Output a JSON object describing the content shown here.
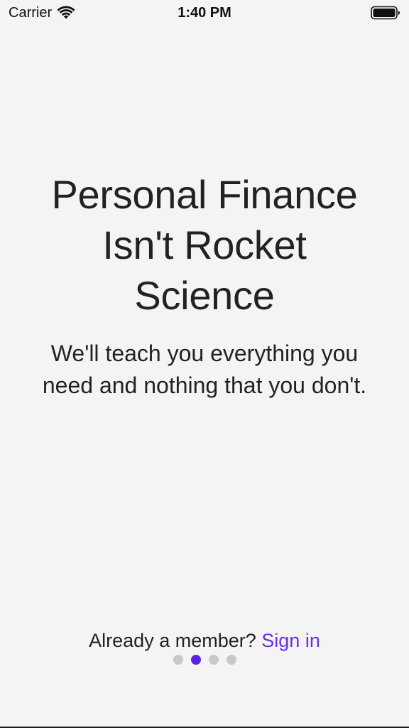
{
  "status_bar": {
    "carrier": "Carrier",
    "time": "1:40 PM",
    "wifi_icon": "wifi-icon",
    "battery_icon": "battery-full-icon"
  },
  "onboarding": {
    "title": "Personal Finance Isn't Rocket Science",
    "subtitle": "We'll teach you everything you need and nothing that you don't."
  },
  "footer": {
    "prompt": "Already a member?",
    "signin_label": "Sign in"
  },
  "pager": {
    "total_pages": 4,
    "current_page": 2
  },
  "colors": {
    "background": "#f4f4f4",
    "text": "#222222",
    "accent": "#6a2ee8",
    "dot_inactive": "#c8c8c8",
    "dot_active": "#5b24e4"
  }
}
